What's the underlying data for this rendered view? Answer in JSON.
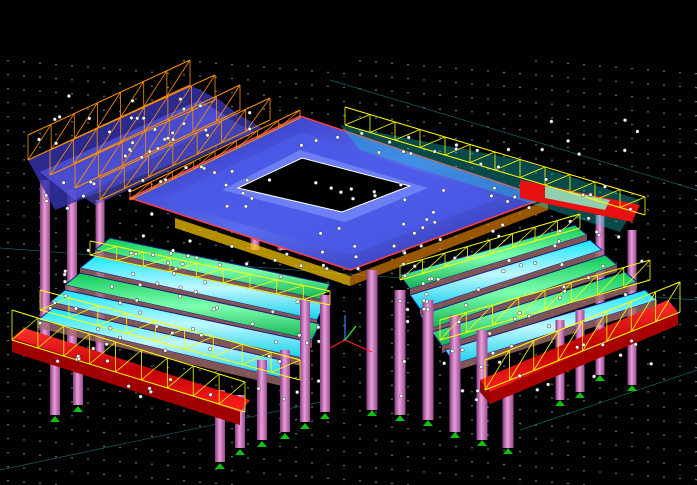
{
  "viewport": {
    "background": "#000000",
    "grid_dot_color": "#8a8a8a",
    "grid_line_color": "#1a8f8f"
  },
  "colors": {
    "column": "#c060b0",
    "column_highlight": "#e8a0d8",
    "slab_blue": "#3c3ccc",
    "slab_light": "#7a8cff",
    "slab_cyan": "#19e6ff",
    "slab_green": "#14e86e",
    "slab_red": "#e81010",
    "truss_yellow": "#ffff00",
    "truss_orange": "#ff9000",
    "node": "#ffffff",
    "support": "#10c010",
    "axis_x": "#ff2020",
    "axis_y": "#20ff20",
    "axis_z": "#3080ff"
  },
  "icons": {
    "axis_triad": "axis-triad-icon",
    "support": "fixed-support-icon"
  }
}
